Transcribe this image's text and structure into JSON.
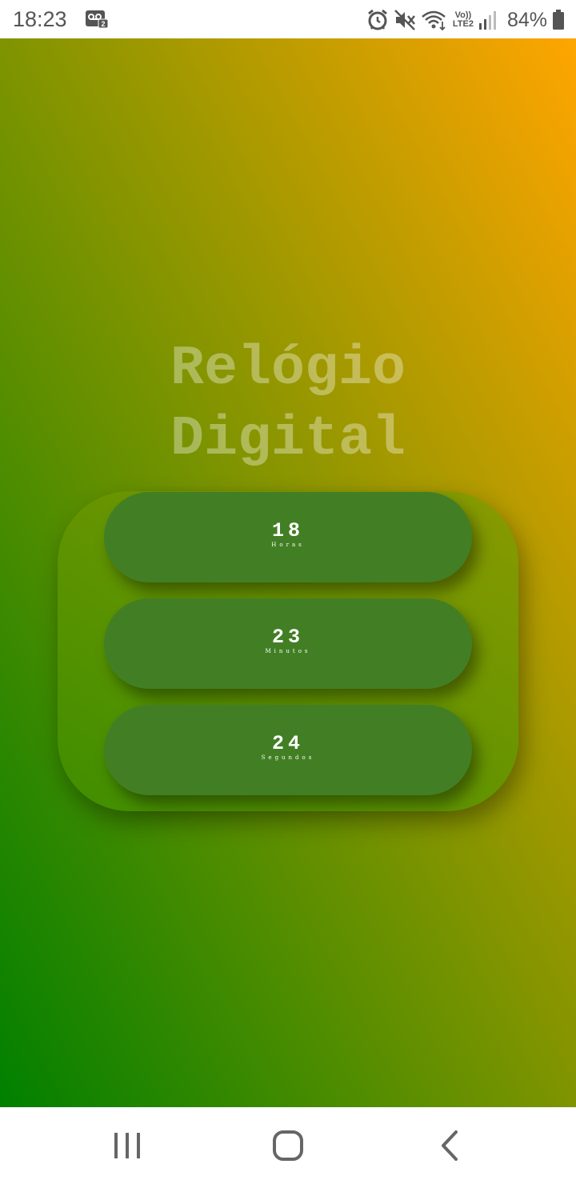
{
  "status_bar": {
    "time": "18:23",
    "voicemail_badge": "2",
    "volte_label": "Vo))",
    "lte_label": "LTE2",
    "battery_percent": "84%",
    "icons": [
      "voicemail-icon",
      "alarm-icon",
      "mute-icon",
      "wifi-icon",
      "signal-icon",
      "battery-icon"
    ]
  },
  "app": {
    "title_line1": "Relógio",
    "title_line2": "Digital",
    "background_colors": [
      "#008000",
      "#ffa500"
    ],
    "pill_color": "#427f24"
  },
  "clock": {
    "hours": {
      "value": "18",
      "label": "Horas"
    },
    "minutes": {
      "value": "23",
      "label": "Minutos"
    },
    "seconds": {
      "value": "24",
      "label": "Segundos"
    }
  },
  "nav_bar": {
    "icons": [
      "recent-apps-icon",
      "home-icon",
      "back-icon"
    ]
  }
}
